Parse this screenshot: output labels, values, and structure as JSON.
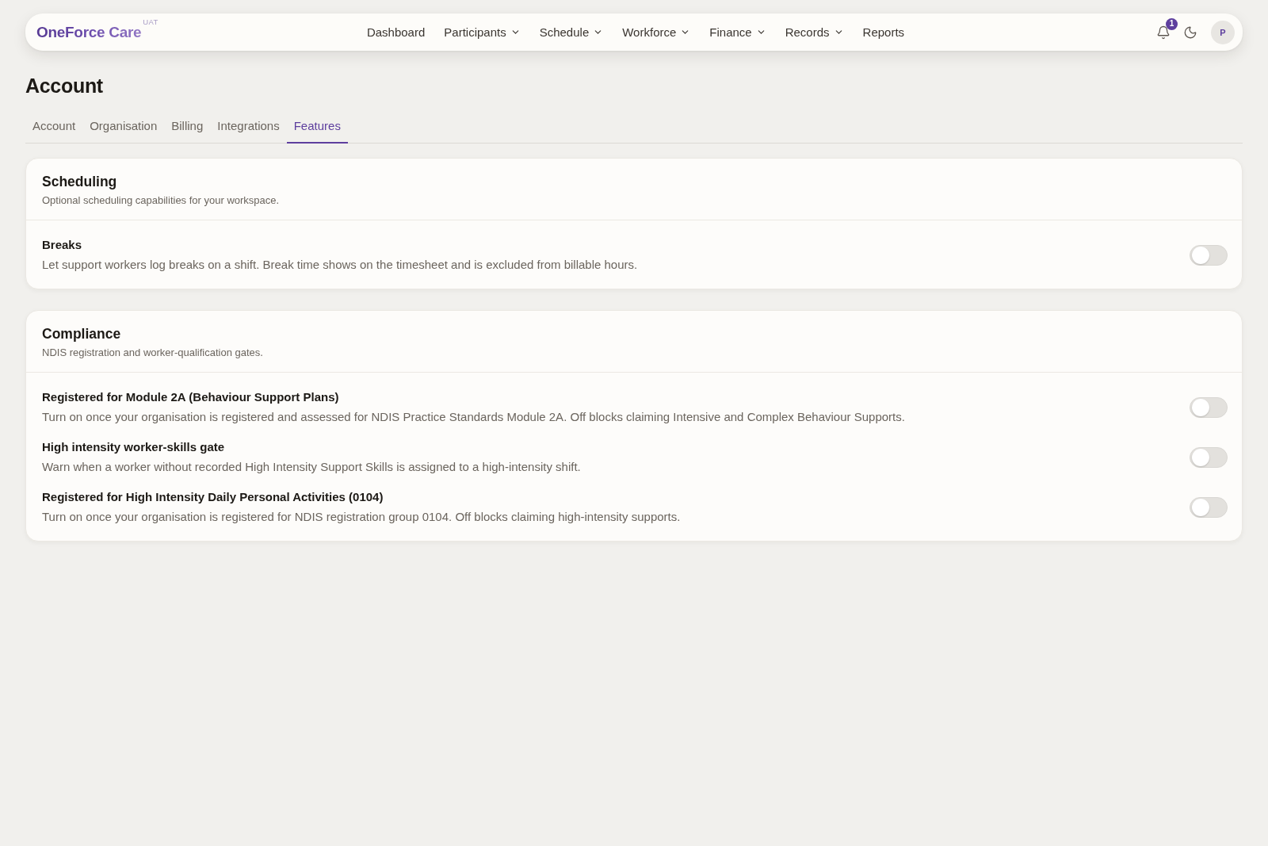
{
  "header": {
    "logo": "OneForce Care",
    "environment": "UAT",
    "nav": [
      {
        "label": "Dashboard",
        "kind": "link"
      },
      {
        "label": "Participants",
        "kind": "menu"
      },
      {
        "label": "Schedule",
        "kind": "menu"
      },
      {
        "label": "Workforce",
        "kind": "menu"
      },
      {
        "label": "Finance",
        "kind": "menu"
      },
      {
        "label": "Records",
        "kind": "menu"
      },
      {
        "label": "Reports",
        "kind": "link"
      }
    ],
    "notifications": {
      "count": "1"
    },
    "avatar": {
      "initial": "P"
    }
  },
  "page_title": "Account",
  "tabs": [
    {
      "label": "Account",
      "selected": false
    },
    {
      "label": "Organisation",
      "selected": false
    },
    {
      "label": "Billing",
      "selected": false
    },
    {
      "label": "Integrations",
      "selected": false
    },
    {
      "label": "Features",
      "selected": true
    }
  ],
  "sections": [
    {
      "title": "Scheduling",
      "subtitle": "Optional scheduling capabilities for your workspace.",
      "features": [
        {
          "name": "Breaks",
          "description": "Let support workers log breaks on a shift. Break time shows on the timesheet and is excluded from billable hours.",
          "on": false
        }
      ]
    },
    {
      "title": "Compliance",
      "subtitle": "NDIS registration and worker-qualification gates.",
      "features": [
        {
          "name": "Registered for Module 2A (Behaviour Support Plans)",
          "description": "Turn on once your organisation is registered and assessed for NDIS Practice Standards Module 2A. Off blocks claiming Intensive and Complex Behaviour Supports.",
          "on": false
        },
        {
          "name": "High intensity worker-skills gate",
          "description": "Warn when a worker without recorded High Intensity Support Skills is assigned to a high-intensity shift.",
          "on": false
        },
        {
          "name": "Registered for High Intensity Daily Personal Activities (0104)",
          "description": "Turn on once your organisation is registered for NDIS registration group 0104. Off blocks claiming high-intensity supports.",
          "on": false
        }
      ]
    }
  ]
}
